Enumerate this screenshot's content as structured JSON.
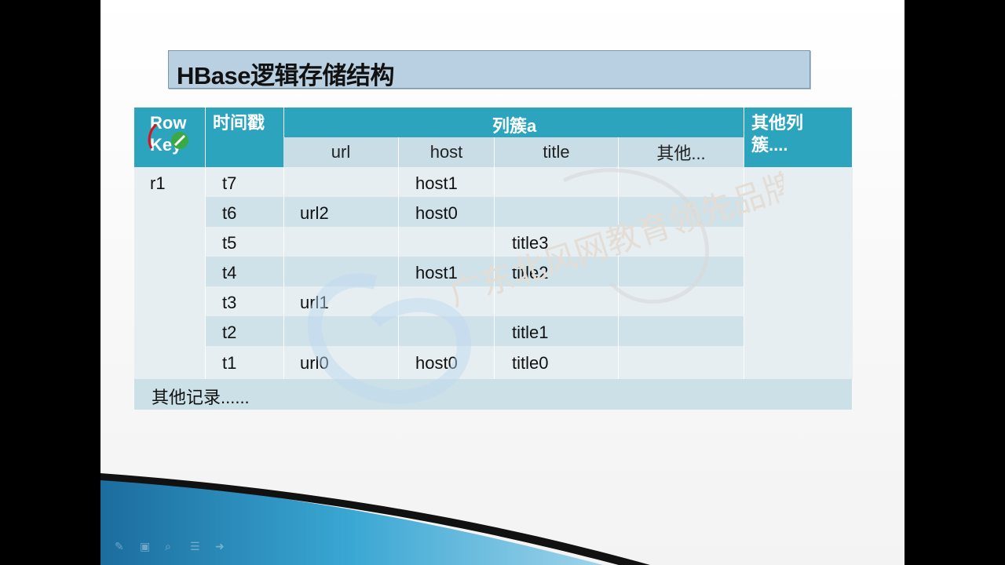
{
  "slide": {
    "title": "HBase逻辑存储结构"
  },
  "table": {
    "header_row_key": "Row Key",
    "header_timestamp": "时间戳",
    "header_family_a": "列簇a",
    "header_other_families": "其他列簇....",
    "columns": [
      "url",
      "host",
      "title",
      "其他..."
    ],
    "row_key_value": "r1",
    "rows": [
      {
        "ts": "t7",
        "url": "",
        "host": "host1",
        "title": "",
        "other": ""
      },
      {
        "ts": "t6",
        "url": "url2",
        "host": "host0",
        "title": "",
        "other": ""
      },
      {
        "ts": "t5",
        "url": "",
        "host": "",
        "title": "title3",
        "other": ""
      },
      {
        "ts": "t4",
        "url": "",
        "host": "host1",
        "title": "title2",
        "other": ""
      },
      {
        "ts": "t3",
        "url": "url1",
        "host": "",
        "title": "",
        "other": ""
      },
      {
        "ts": "t2",
        "url": "",
        "host": "",
        "title": "title1",
        "other": ""
      },
      {
        "ts": "t1",
        "url": "url0",
        "host": "host0",
        "title": "title0",
        "other": ""
      }
    ],
    "other_records": "其他记录......"
  },
  "watermark": {
    "line": "广东北风网教育领先品牌"
  },
  "colors": {
    "header": "#2da4be",
    "subheader": "#c8dde6",
    "title_box": "#b9d0e2",
    "band_dark": "#cfe1e9",
    "band_light": "#e6eef2"
  },
  "toolbar": {
    "icons": [
      "pen-icon",
      "slide-icon",
      "search-icon",
      "menu-icon",
      "pointer-icon"
    ]
  }
}
